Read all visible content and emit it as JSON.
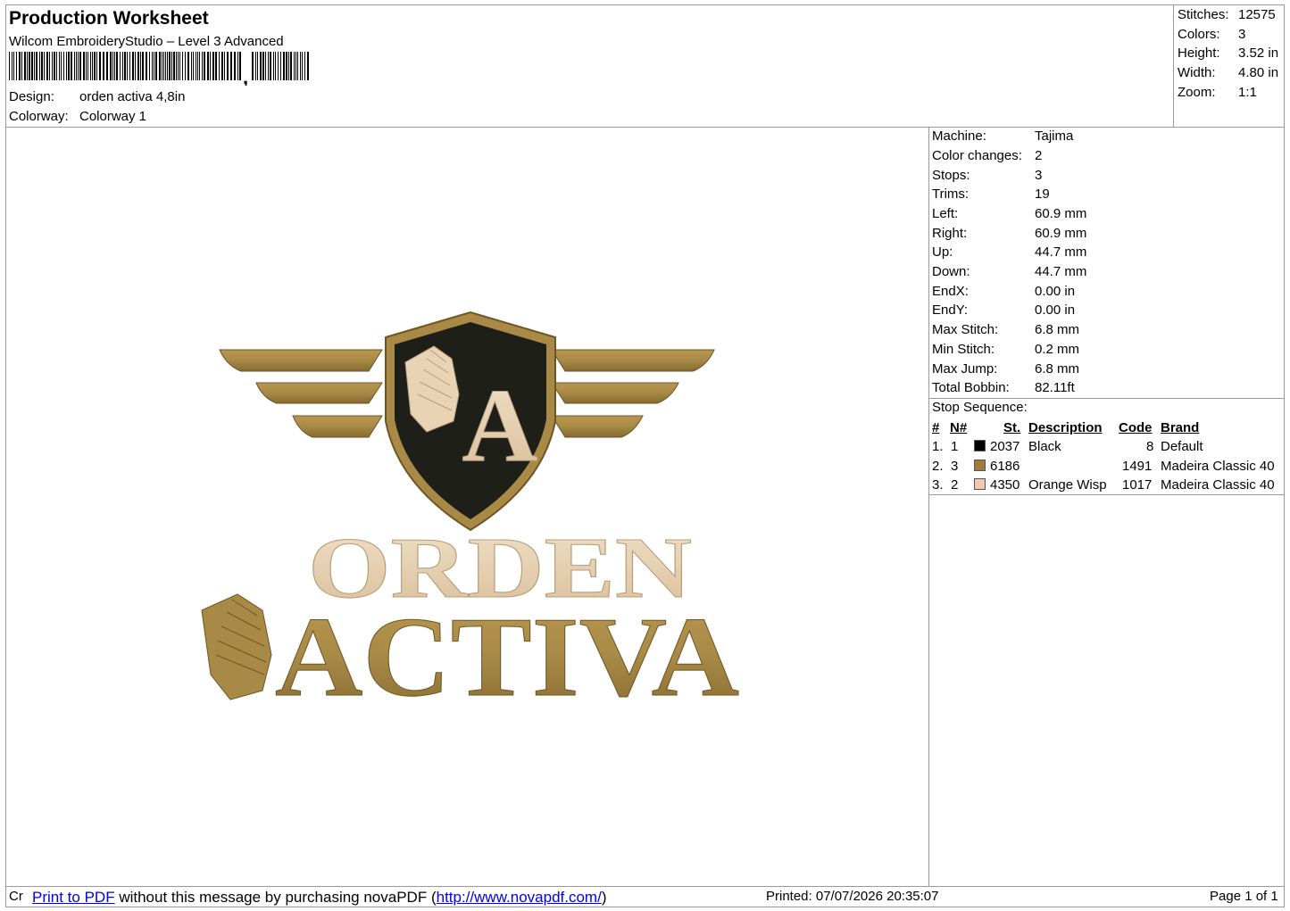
{
  "header": {
    "title": "Production Worksheet",
    "software": "Wilcom EmbroideryStudio – Level 3 Advanced",
    "design_label": "Design:",
    "design_value": "orden activa 4,8in",
    "colorway_label": "Colorway:",
    "colorway_value": "Colorway 1"
  },
  "summary": [
    {
      "label": "Stitches:",
      "value": "12575"
    },
    {
      "label": "Colors:",
      "value": "3"
    },
    {
      "label": "Height:",
      "value": "3.52 in"
    },
    {
      "label": "Width:",
      "value": "4.80 in"
    },
    {
      "label": "Zoom:",
      "value": "1:1"
    }
  ],
  "machine_info": [
    {
      "label": "Machine:",
      "value": "Tajima"
    },
    {
      "label": "Color changes:",
      "value": "2"
    },
    {
      "label": "Stops:",
      "value": "3"
    },
    {
      "label": "Trims:",
      "value": "19"
    },
    {
      "label": "Left:",
      "value": "60.9 mm"
    },
    {
      "label": "Right:",
      "value": "60.9 mm"
    },
    {
      "label": "Up:",
      "value": "44.7 mm"
    },
    {
      "label": "Down:",
      "value": "44.7 mm"
    },
    {
      "label": "EndX:",
      "value": "0.00 in"
    },
    {
      "label": "EndY:",
      "value": "0.00 in"
    },
    {
      "label": "Max Stitch:",
      "value": "6.8 mm"
    },
    {
      "label": "Min Stitch:",
      "value": "0.2 mm"
    },
    {
      "label": "Max Jump:",
      "value": "6.8 mm"
    },
    {
      "label": "Total Bobbin:",
      "value": "82.11ft"
    }
  ],
  "stop_sequence": {
    "title": "Stop Sequence:",
    "columns": [
      "#",
      "N#",
      "St.",
      "Description",
      "Code",
      "Brand"
    ],
    "rows": [
      {
        "idx": "1.",
        "n": "1",
        "color": "#000000",
        "st": "2037",
        "desc": "Black",
        "code": "8",
        "brand": "Default"
      },
      {
        "idx": "2.",
        "n": "3",
        "color": "#a47a3c",
        "st": "6186",
        "desc": "",
        "code": "1491",
        "brand": "Madeira Classic 40"
      },
      {
        "idx": "3.",
        "n": "2",
        "color": "#f4c7b2",
        "st": "4350",
        "desc": "Orange Wisp",
        "code": "1017",
        "brand": "Madeira Classic 40"
      }
    ]
  },
  "design_text": {
    "letter": "A",
    "line1": "ORDEN",
    "line2": "ACTIVA"
  },
  "colors": {
    "gold": "#a88a46",
    "gold_dark": "#6e5524",
    "cream": "#e8d3b5",
    "shield": "#1f1f1a"
  },
  "footer": {
    "prefix": "Cr",
    "link_text": "Print to PDF",
    "message": " without this message by purchasing novaPDF (",
    "url": "http://www.novapdf.com/",
    "close": ")",
    "printed": "Printed: 07/07/2026 20:35:07",
    "page": "Page 1 of 1"
  }
}
